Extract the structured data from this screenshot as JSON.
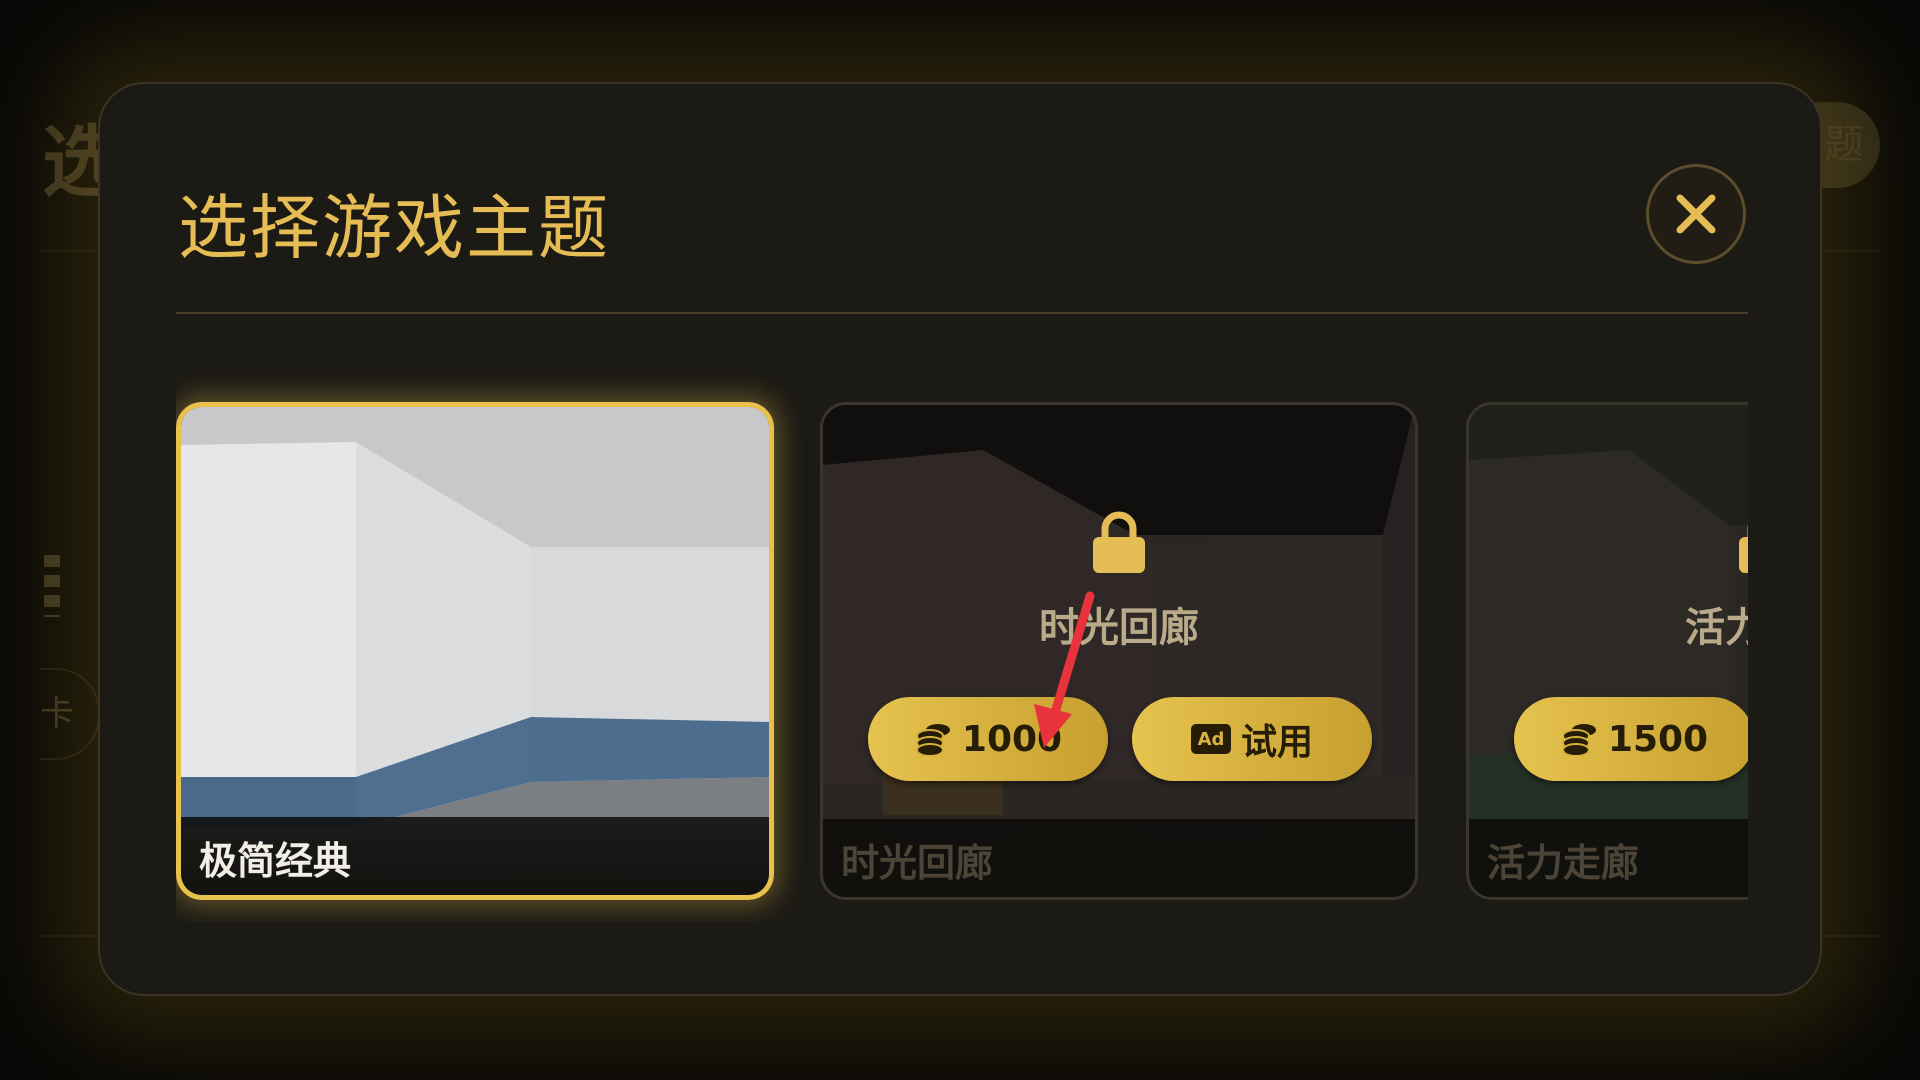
{
  "modal": {
    "title": "选择游戏主题",
    "close_icon": "close-icon"
  },
  "background": {
    "title_fragment": "选",
    "pill_fragment": "题",
    "side_pill_fragment": "卡"
  },
  "themes": [
    {
      "name": "极简经典",
      "selected": true,
      "locked": false
    },
    {
      "name": "时光回廊",
      "selected": false,
      "locked": true,
      "overlay_title": "时光回廊",
      "price": "1000",
      "trial_label": "试用",
      "ad_badge": "Ad"
    },
    {
      "name": "活力走廊",
      "selected": false,
      "locked": true,
      "overlay_title": "活力走廊",
      "price": "1500"
    }
  ],
  "colors": {
    "accent": "#e6bd55",
    "button_gold": "#e6c24e",
    "annotation_arrow": "#e8323c"
  },
  "icons": [
    "lock-icon",
    "coin-stack-icon",
    "ad-icon",
    "close-icon",
    "annotation-arrow"
  ]
}
